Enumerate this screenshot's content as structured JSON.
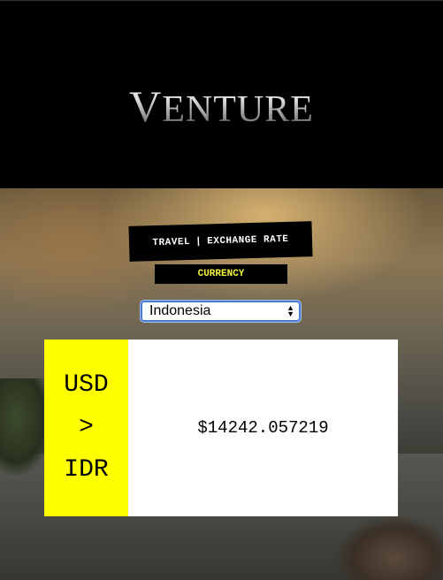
{
  "header": {
    "logo_first": "V",
    "logo_rest": "ENTURE"
  },
  "section": {
    "title_left": "TRAVEL",
    "title_sep": "|",
    "title_right": "EXCHANGE RATE",
    "currency_label": "CURRENCY"
  },
  "country_select": {
    "selected": "Indonesia",
    "icon": "select-arrows-icon"
  },
  "conversion": {
    "from": "USD",
    "arrow": ">",
    "to": "IDR",
    "rate": "$14242.057219"
  },
  "colors": {
    "accent_yellow": "#ffff00",
    "currency_text": "#f2f23a",
    "select_focus": "#4a7bd6"
  }
}
